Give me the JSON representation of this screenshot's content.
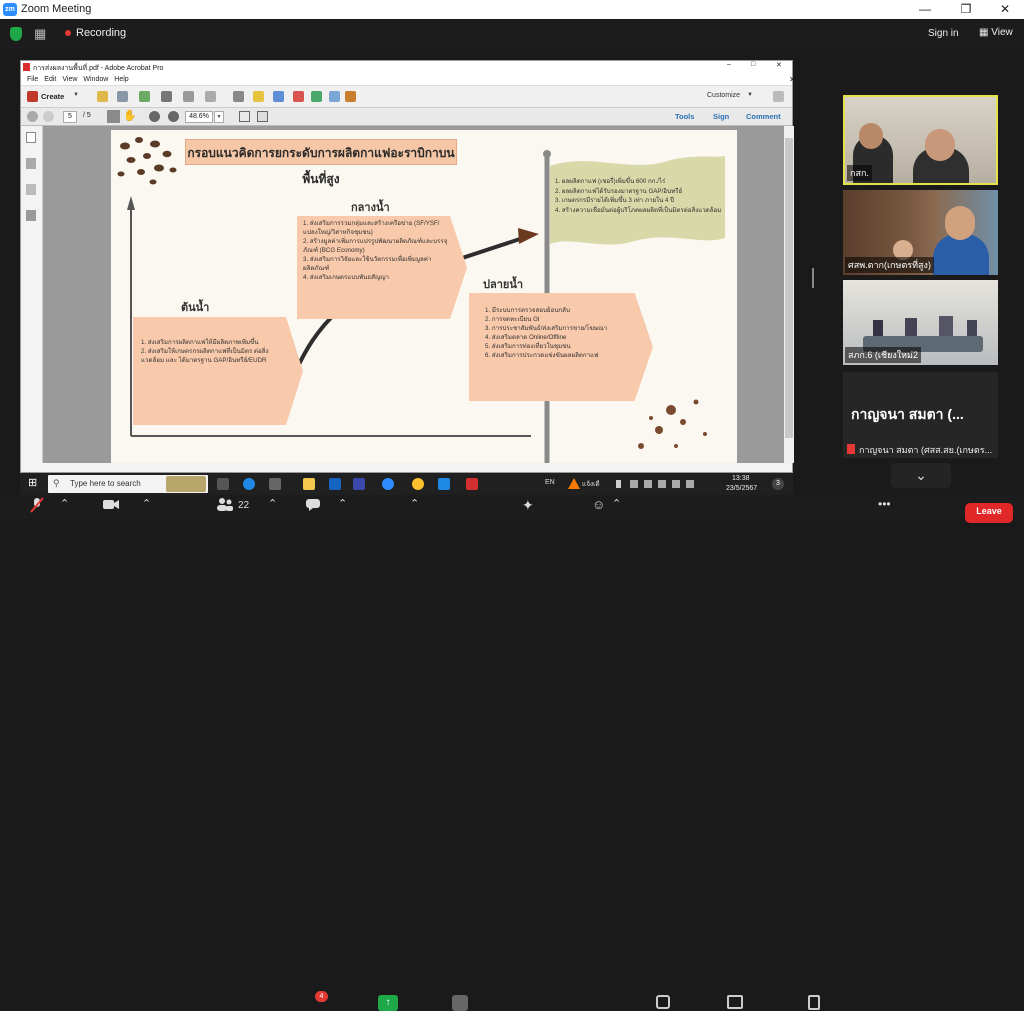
{
  "zoom": {
    "app_badge": "zm",
    "window_title": "Zoom Meeting",
    "recording_label": "Recording",
    "sign_in": "Sign in",
    "view_label": "View",
    "participant_count": "22",
    "chat_badge": "4",
    "leave_label": "Leave"
  },
  "acrobat": {
    "title": "การส่งผลงานพื้นที่.pdf - Adobe Acrobat Pro",
    "menu": [
      "File",
      "Edit",
      "View",
      "Window",
      "Help"
    ],
    "create_label": "Create",
    "customize_label": "Customize",
    "page_current": "5",
    "page_total": "/ 5",
    "zoom": "48.6%",
    "tools_label": "Tools",
    "sign_label": "Sign",
    "comment_label": "Comment"
  },
  "slide": {
    "title": "กรอบแนวคิดการยกระดับการผลิตกาแฟอะราบิกาบนพื้นที่สูง",
    "upstream": {
      "heading": "ต้นน้ำ",
      "items": [
        "1. ส่งเสริมการผลิตกาแฟให้มีผลิตภาพเพิ่มขึ้น",
        "2. ส่งเสริมให้เกษตรกรผลิตกาแฟที่เป็นมิตร ต่อสิ่งแวดล้อม และ ได้มาตรฐาน GAP/อินทรีย์/EUDR"
      ]
    },
    "midstream": {
      "heading": "กลางน้ำ",
      "items": [
        "1. ส่งเสริมการรวมกลุ่มและสร้างเครือข่าย (SF/YSF/แปลงใหญ่/วิสาหกิจชุมชน)",
        "2. สร้างมูลค่าเพิ่มการแปรรูปพัฒนาผลิตภัณฑ์และบรรจุภัณฑ์ (BCG Economy)",
        "3. ส่งเสริมการวิจัยและใช้นวัตกรรมเพื่อเพิ่มมูลค่าผลิตภัณฑ์",
        "4. ส่งเสริมเกษตรแบบพันธสัญญา"
      ]
    },
    "downstream": {
      "heading": "ปลายน้ำ",
      "items": [
        "1. มีระบบการตรวจสอบย้อนกลับ",
        "2. การจดทะเบียน GI",
        "3. การประชาสัมพันธ์/ส่งเสริมการขาย/โฆษณา",
        "4. ส่งเสริมตลาด Online/Offline",
        "5. ส่งเสริมการท่องเที่ยวในชุมชน",
        "6. ส่งเสริมการประกวดแข่งขันผลผลิตกาแฟ"
      ]
    },
    "goals": [
      "1. ผลผลิตกาแฟ (เชอรี่)เพิ่มขึ้น 600 กก./ไร่",
      "2. ผลผลิตกาแฟได้รับรองมาตรฐาน GAP/อินทรีย์",
      "3. เกษตรกรมีรายได้เพิ่มขึ้น 3 เท่า ภายใน 4 ปี",
      "4. สร้างความเชื่อมั่นต่อผู้บริโภคผลผลิตที่เป็นมิตรต่อสิ่งแวดล้อม"
    ]
  },
  "taskbar": {
    "search_placeholder": "Type here to search",
    "lang": "EN",
    "time": "13:38",
    "date": "23/5/2567",
    "notif_badge": "3",
    "weather_label": "แจ้งเตื"
  },
  "participants": [
    {
      "name": "กสก."
    },
    {
      "name": "ศสพ.ตาก(เกษตรที่สูง)"
    },
    {
      "name": "สภก.6 (เชียงใหม่2"
    },
    {
      "name": "กาญจนา สมตา (ศสส.สย.(เกษตร..."
    }
  ],
  "tile_text_name": "กาญจนา สมตา (...",
  "colors": {
    "zoom_blue": "#2d8cff",
    "record_red": "#e53935",
    "leave_red": "#e02828",
    "active_speaker": "#e4e24a",
    "slide_peach": "#f8c9aa",
    "flag_olive": "#d8d8a8"
  }
}
